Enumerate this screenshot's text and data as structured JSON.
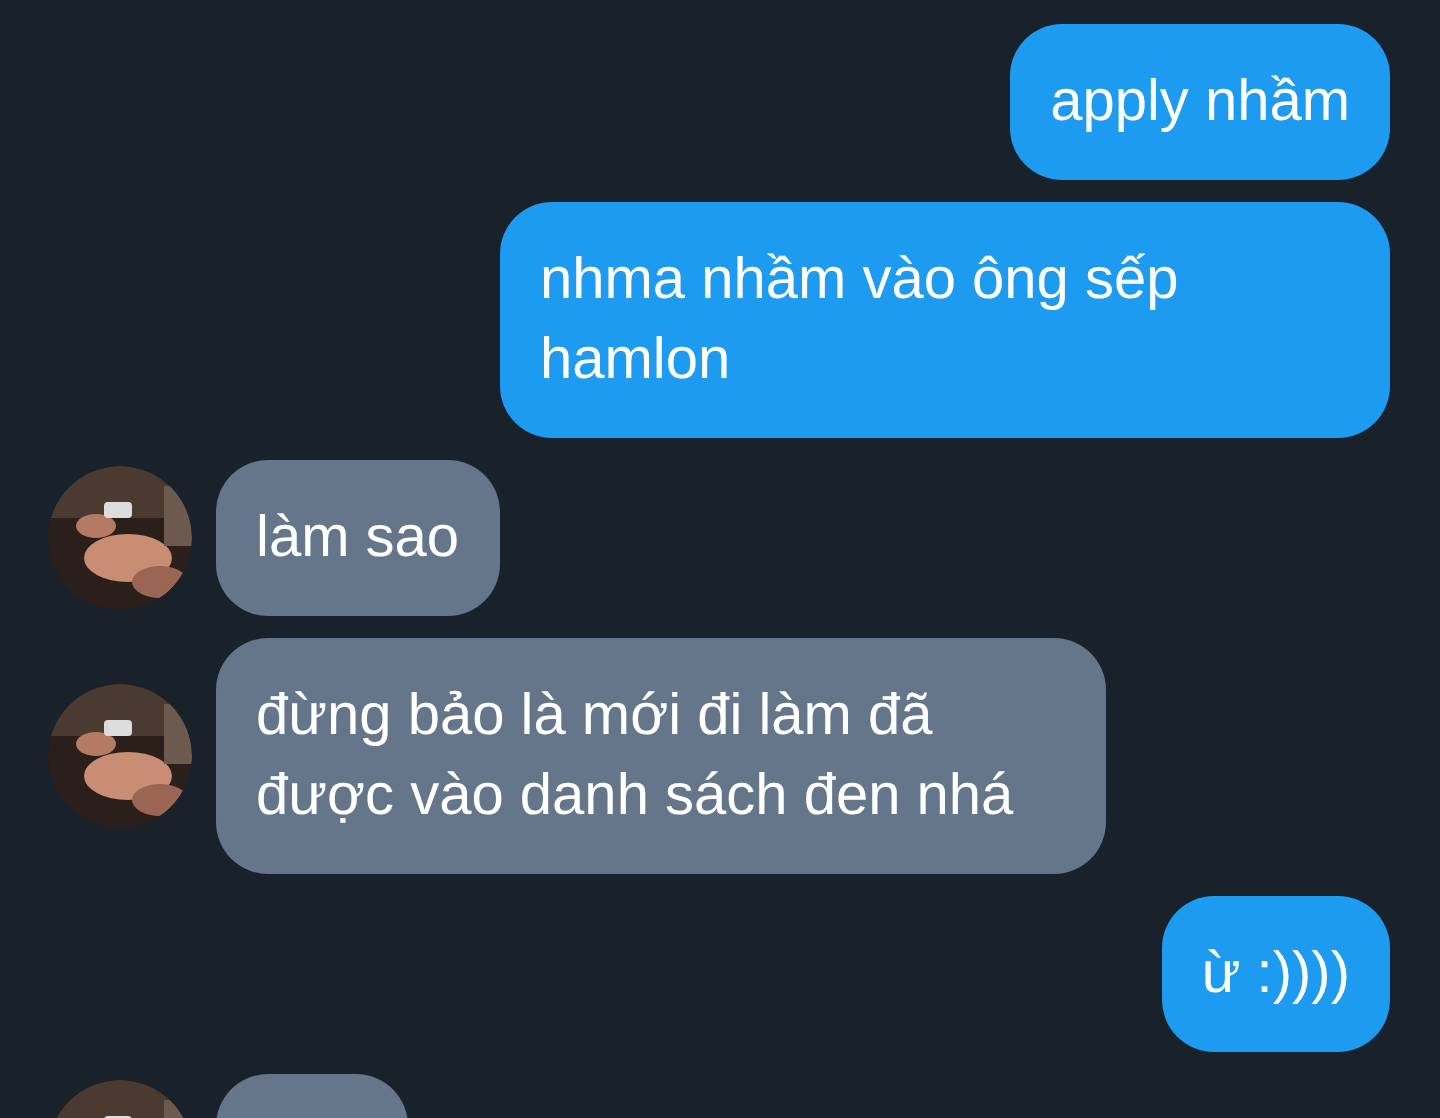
{
  "messages": [
    {
      "kind": "outgoing",
      "text": "apply nhầm"
    },
    {
      "kind": "outgoing",
      "text": "nhma nhầm vào ông sếp hamlon"
    },
    {
      "kind": "incoming",
      "text": "làm sao"
    },
    {
      "kind": "incoming",
      "text": "đừng bảo là mới đi làm đã được vào danh sách đen nhá"
    },
    {
      "kind": "outgoing",
      "text": "ừ :))))"
    },
    {
      "kind": "incoming"
    }
  ]
}
